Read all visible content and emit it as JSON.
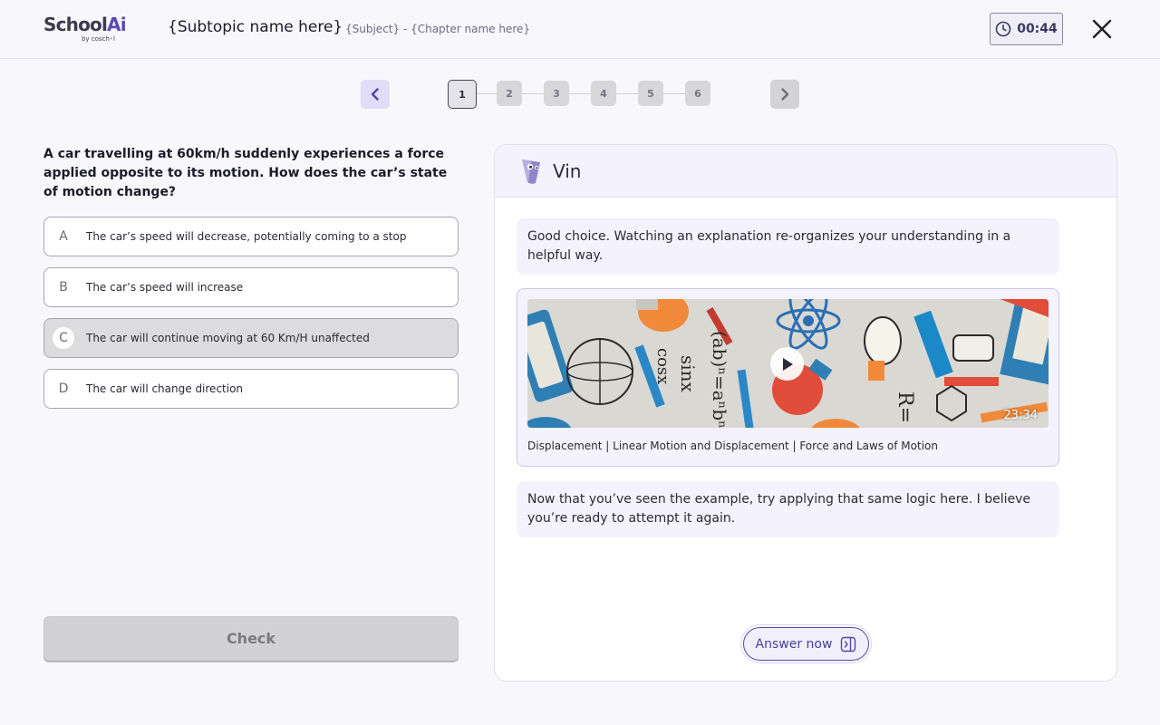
{
  "header": {
    "logo_main": "School",
    "logo_ai": "Ai",
    "logo_sub": "by cosch",
    "logo_sub_dot": "•",
    "logo_sub_end": "l",
    "subtopic": "{Subtopic name here}",
    "subject_chapter": "{Subject} - {Chapter name here}",
    "timer": "00:44",
    "timer_icon": "clock-icon",
    "close_icon": "close-icon"
  },
  "stepper": {
    "prev_icon": "chevron-left-icon",
    "next_icon": "chevron-right-icon",
    "steps": [
      "1",
      "2",
      "3",
      "4",
      "5",
      "6"
    ],
    "active_step": "1"
  },
  "question": {
    "text": "A car travelling at 60km/h suddenly experiences a force applied opposite to its motion. How does the car’s state of motion change?",
    "options": [
      {
        "letter": "A",
        "text": "The car’s speed will decrease, potentially coming to a stop"
      },
      {
        "letter": "B",
        "text": "The car’s speed will increase"
      },
      {
        "letter": "C",
        "text": "The car will continue moving at 60 Km/H unaffected"
      },
      {
        "letter": "D",
        "text": "The car will change direction"
      }
    ],
    "selected": "C",
    "check_label": "Check"
  },
  "chat": {
    "assistant_name": "Vin",
    "messages": [
      "Good choice. Watching an explanation re-organizes your understanding in a helpful way.",
      "Now that you’ve seen the example, try applying that same logic here. I believe you’re ready to attempt it again."
    ],
    "video": {
      "duration": "23:34",
      "caption": "Displacement | Linear Motion and Displacement | Force and Laws of Motion",
      "play_icon": "play-icon"
    },
    "answer_now_label": "Answer now",
    "answer_now_icon": "panel-right-icon"
  },
  "colors": {
    "accent": "#5446a6",
    "background": "#f8f7fc",
    "bubble": "#f4f2fc"
  }
}
